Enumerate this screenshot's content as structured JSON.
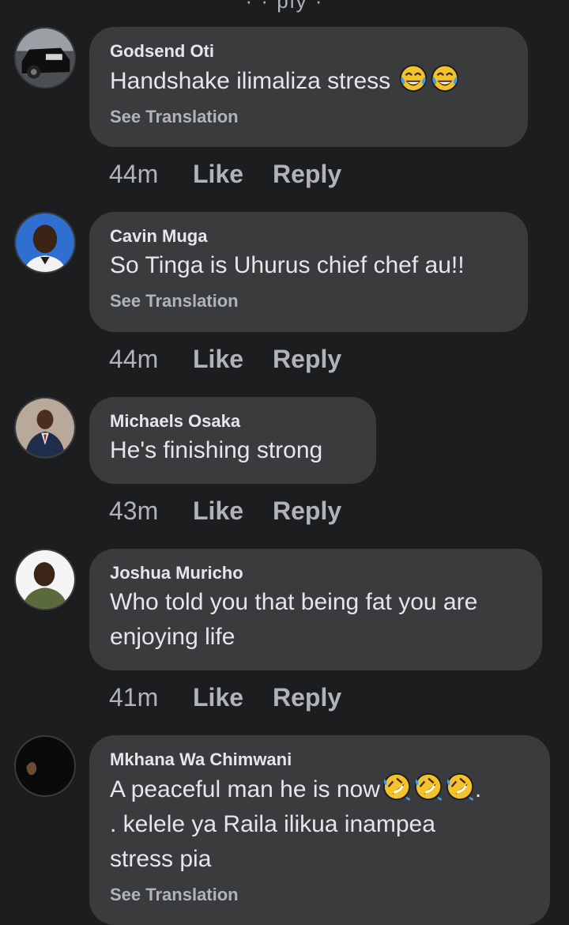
{
  "top_sliver": "· · ply ·",
  "comments": [
    {
      "name": "Godsend Oti",
      "text": "Handshake ilimaliza stress",
      "emojis": [
        "tears-of-joy-emoji",
        "tears-of-joy-emoji"
      ],
      "see_translation": "See Translation",
      "time": "44m",
      "like": "Like",
      "reply": "Reply"
    },
    {
      "name": "Cavin Muga",
      "text": "So Tinga is Uhurus chief chef au!!",
      "see_translation": "See Translation",
      "time": "44m",
      "like": "Like",
      "reply": "Reply"
    },
    {
      "name": "Michaels Osaka",
      "text": "He's finishing strong",
      "time": "43m",
      "like": "Like",
      "reply": "Reply"
    },
    {
      "name": "Joshua Muricho",
      "text_line1": "Who told you that being fat you are",
      "text_line2": "enjoying life",
      "time": "41m",
      "like": "Like",
      "reply": "Reply"
    },
    {
      "name": "Mkhana Wa Chimwani",
      "text_line1": "A peaceful man he is now",
      "text_line1_end": ".",
      "text_line2": ". kelele ya Raila ilikua inampea",
      "text_line3": "stress pia",
      "emojis": [
        "rolling-laughing-emoji",
        "rolling-laughing-emoji",
        "rolling-laughing-emoji"
      ],
      "see_translation": "See Translation"
    }
  ],
  "colors": {
    "background": "#1c1d1f",
    "bubble": "#3a3b3c",
    "primary_text": "#e4e6eb",
    "secondary_text": "#b0b3b8",
    "emoji_face": "#f4c22b",
    "emoji_tears": "#3b9fe3"
  }
}
